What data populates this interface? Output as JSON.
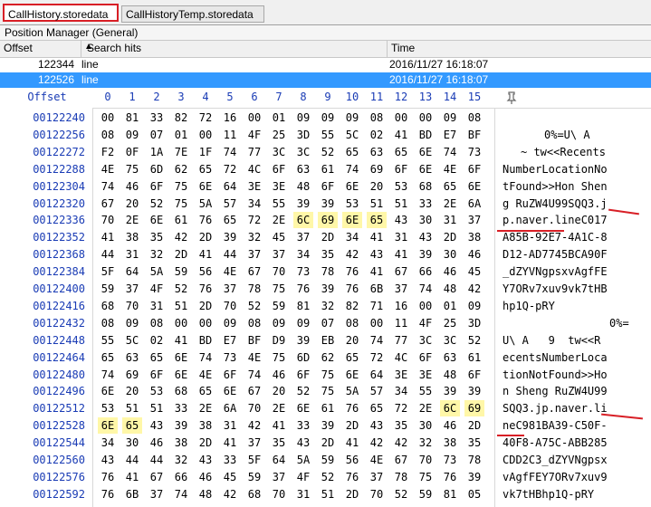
{
  "tabs": [
    {
      "label": "CallHistory.storedata"
    },
    {
      "label": "CallHistoryTemp.storedata"
    }
  ],
  "position_manager": {
    "title": "Position Manager (General)",
    "columns": [
      "Offset",
      "Search hits",
      "Time"
    ],
    "rows": [
      {
        "offset": "122344",
        "hit": "line",
        "time": "2016/11/27  16:18:07"
      },
      {
        "offset": "122526",
        "hit": "line",
        "time": "2016/11/27  16:18:07"
      }
    ]
  },
  "hex_header": {
    "label": "Offset",
    "columns": [
      "0",
      "1",
      "2",
      "3",
      "4",
      "5",
      "6",
      "7",
      "8",
      "9",
      "10",
      "11",
      "12",
      "13",
      "14",
      "15"
    ]
  },
  "hex_rows": [
    {
      "offset": "00122240",
      "bytes": [
        "00",
        "81",
        "33",
        "82",
        "72",
        "16",
        "00",
        "01",
        "09",
        "09",
        "09",
        "08",
        "00",
        "00",
        "09",
        "08"
      ],
      "text": ""
    },
    {
      "offset": "00122256",
      "bytes": [
        "08",
        "09",
        "07",
        "01",
        "00",
        "11",
        "4F",
        "25",
        "3D",
        "55",
        "5C",
        "02",
        "41",
        "BD",
        "E7",
        "BF"
      ],
      "text": "0%=U\\ A"
    },
    {
      "offset": "00122272",
      "bytes": [
        "F2",
        "0F",
        "1A",
        "7E",
        "1F",
        "74",
        "77",
        "3C",
        "3C",
        "52",
        "65",
        "63",
        "65",
        "6E",
        "74",
        "73"
      ],
      "text": "~ tw<<Recents"
    },
    {
      "offset": "00122288",
      "bytes": [
        "4E",
        "75",
        "6D",
        "62",
        "65",
        "72",
        "4C",
        "6F",
        "63",
        "61",
        "74",
        "69",
        "6F",
        "6E",
        "4E",
        "6F"
      ],
      "text": "NumberLocationNo"
    },
    {
      "offset": "00122304",
      "bytes": [
        "74",
        "46",
        "6F",
        "75",
        "6E",
        "64",
        "3E",
        "3E",
        "48",
        "6F",
        "6E",
        "20",
        "53",
        "68",
        "65",
        "6E"
      ],
      "text": "tFound>>Hon Shen"
    },
    {
      "offset": "00122320",
      "bytes": [
        "67",
        "20",
        "52",
        "75",
        "5A",
        "57",
        "34",
        "55",
        "39",
        "39",
        "53",
        "51",
        "51",
        "33",
        "2E",
        "6A"
      ],
      "text": "g RuZW4U99SQQ3.j"
    },
    {
      "offset": "00122336",
      "bytes": [
        "70",
        "2E",
        "6E",
        "61",
        "76",
        "65",
        "72",
        "2E",
        "6C",
        "69",
        "6E",
        "65",
        "43",
        "30",
        "31",
        "37"
      ],
      "text": "p.naver.lineC017"
    },
    {
      "offset": "00122352",
      "bytes": [
        "41",
        "38",
        "35",
        "42",
        "2D",
        "39",
        "32",
        "45",
        "37",
        "2D",
        "34",
        "41",
        "31",
        "43",
        "2D",
        "38"
      ],
      "text": "A85B-92E7-4A1C-8"
    },
    {
      "offset": "00122368",
      "bytes": [
        "44",
        "31",
        "32",
        "2D",
        "41",
        "44",
        "37",
        "37",
        "34",
        "35",
        "42",
        "43",
        "41",
        "39",
        "30",
        "46"
      ],
      "text": "D12-AD7745BCA90F"
    },
    {
      "offset": "00122384",
      "bytes": [
        "5F",
        "64",
        "5A",
        "59",
        "56",
        "4E",
        "67",
        "70",
        "73",
        "78",
        "76",
        "41",
        "67",
        "66",
        "46",
        "45"
      ],
      "text": "_dZYVNgpsxvAgfFE"
    },
    {
      "offset": "00122400",
      "bytes": [
        "59",
        "37",
        "4F",
        "52",
        "76",
        "37",
        "78",
        "75",
        "76",
        "39",
        "76",
        "6B",
        "37",
        "74",
        "48",
        "42"
      ],
      "text": "Y7ORv7xuv9vk7tHB"
    },
    {
      "offset": "00122416",
      "bytes": [
        "68",
        "70",
        "31",
        "51",
        "2D",
        "70",
        "52",
        "59",
        "81",
        "32",
        "82",
        "71",
        "16",
        "00",
        "01",
        "09"
      ],
      "text": "hp1Q-pRY"
    },
    {
      "offset": "00122432",
      "bytes": [
        "08",
        "09",
        "08",
        "00",
        "00",
        "09",
        "08",
        "09",
        "09",
        "07",
        "08",
        "00",
        "11",
        "4F",
        "25",
        "3D"
      ],
      "text": "0%="
    },
    {
      "offset": "00122448",
      "bytes": [
        "55",
        "5C",
        "02",
        "41",
        "BD",
        "E7",
        "BF",
        "D9",
        "39",
        "EB",
        "20",
        "74",
        "77",
        "3C",
        "3C",
        "52"
      ],
      "text": "U\\ A   9  tw<<R"
    },
    {
      "offset": "00122464",
      "bytes": [
        "65",
        "63",
        "65",
        "6E",
        "74",
        "73",
        "4E",
        "75",
        "6D",
        "62",
        "65",
        "72",
        "4C",
        "6F",
        "63",
        "61"
      ],
      "text": "ecentsNumberLoca"
    },
    {
      "offset": "00122480",
      "bytes": [
        "74",
        "69",
        "6F",
        "6E",
        "4E",
        "6F",
        "74",
        "46",
        "6F",
        "75",
        "6E",
        "64",
        "3E",
        "3E",
        "48",
        "6F"
      ],
      "text": "tionNotFound>>Ho"
    },
    {
      "offset": "00122496",
      "bytes": [
        "6E",
        "20",
        "53",
        "68",
        "65",
        "6E",
        "67",
        "20",
        "52",
        "75",
        "5A",
        "57",
        "34",
        "55",
        "39",
        "39"
      ],
      "text": "n Sheng RuZW4U99"
    },
    {
      "offset": "00122512",
      "bytes": [
        "53",
        "51",
        "51",
        "33",
        "2E",
        "6A",
        "70",
        "2E",
        "6E",
        "61",
        "76",
        "65",
        "72",
        "2E",
        "6C",
        "69"
      ],
      "text": "SQQ3.jp.naver.li"
    },
    {
      "offset": "00122528",
      "bytes": [
        "6E",
        "65",
        "43",
        "39",
        "38",
        "31",
        "42",
        "41",
        "33",
        "39",
        "2D",
        "43",
        "35",
        "30",
        "46",
        "2D"
      ],
      "text": "neC981BA39-C50F-"
    },
    {
      "offset": "00122544",
      "bytes": [
        "34",
        "30",
        "46",
        "38",
        "2D",
        "41",
        "37",
        "35",
        "43",
        "2D",
        "41",
        "42",
        "42",
        "32",
        "38",
        "35"
      ],
      "text": "40F8-A75C-ABB285"
    },
    {
      "offset": "00122560",
      "bytes": [
        "43",
        "44",
        "44",
        "32",
        "43",
        "33",
        "5F",
        "64",
        "5A",
        "59",
        "56",
        "4E",
        "67",
        "70",
        "73",
        "78"
      ],
      "text": "CDD2C3_dZYVNgpsx"
    },
    {
      "offset": "00122576",
      "bytes": [
        "76",
        "41",
        "67",
        "66",
        "46",
        "45",
        "59",
        "37",
        "4F",
        "52",
        "76",
        "37",
        "78",
        "75",
        "76",
        "39"
      ],
      "text": "vAgfFEY7ORv7xuv9"
    },
    {
      "offset": "00122592",
      "bytes": [
        "76",
        "6B",
        "37",
        "74",
        "48",
        "42",
        "68",
        "70",
        "31",
        "51",
        "2D",
        "70",
        "52",
        "59",
        "81",
        "05"
      ],
      "text": "vk7tHBhp1Q-pRY"
    }
  ],
  "highlight_color": "#fff7a8",
  "selection_color": "#3399ff",
  "annotation_color": "#d81f26",
  "icons": {
    "pin": "pin-icon",
    "sort": "sort-arrow-icon"
  }
}
